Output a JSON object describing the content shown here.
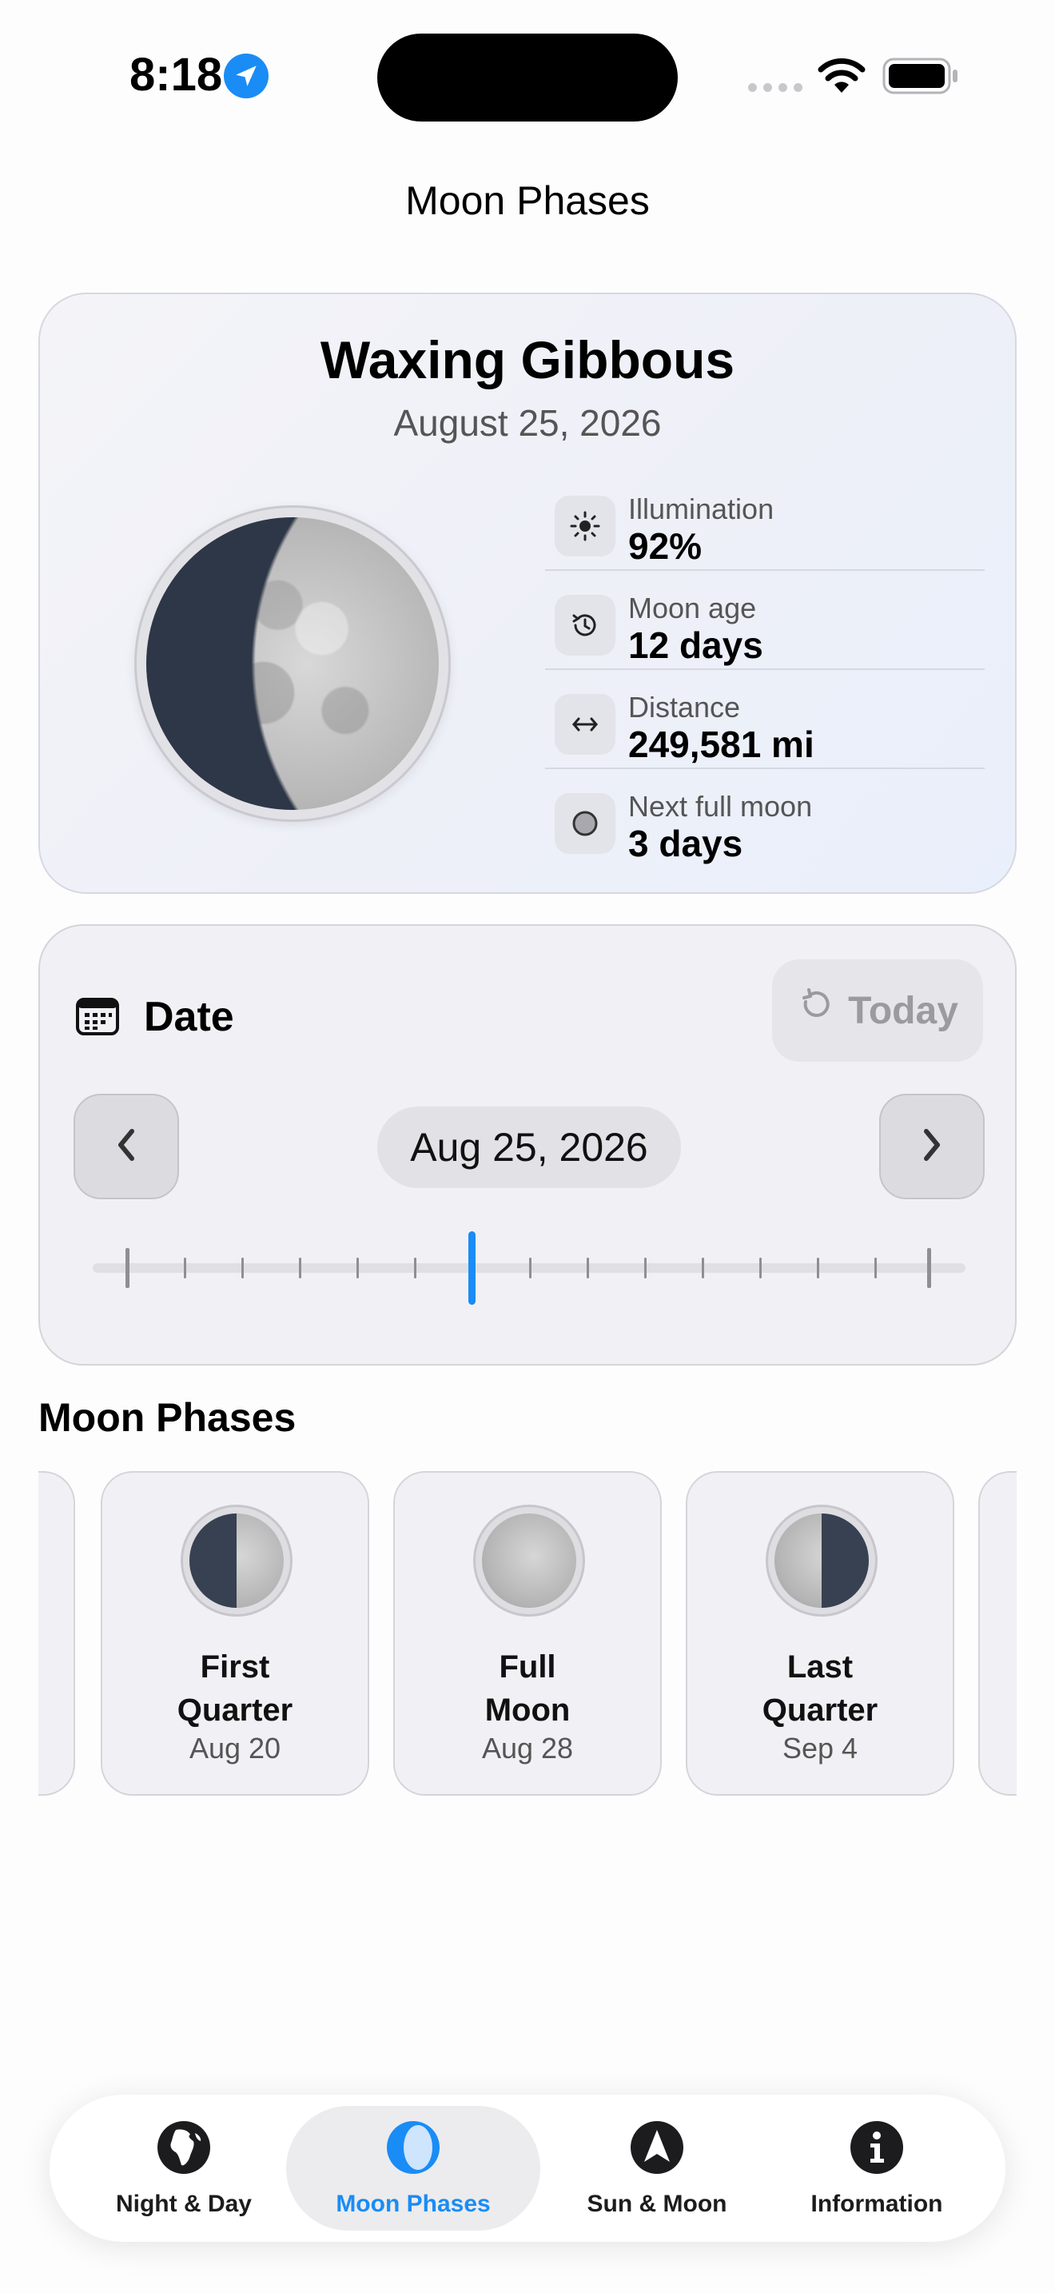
{
  "status_bar": {
    "time": "8:18",
    "icons": [
      "location-arrow-icon",
      "signal-icon",
      "wifi-icon",
      "battery-icon"
    ]
  },
  "header": {
    "title": "Moon Phases"
  },
  "moon_card": {
    "phase_name": "Waxing Gibbous",
    "date": "August 25, 2026",
    "stats": [
      {
        "icon": "sun-icon",
        "label": "Illumination",
        "value": "92%"
      },
      {
        "icon": "history-icon",
        "label": "Moon age",
        "value": "12 days"
      },
      {
        "icon": "arrows-horizontal-icon",
        "label": "Distance",
        "value": "249,581 mi"
      },
      {
        "icon": "circle-icon",
        "label": "Next full moon",
        "value": "3 days"
      }
    ]
  },
  "date_card": {
    "heading": "Date",
    "today_label": "Today",
    "selected_date": "Aug 25, 2026"
  },
  "phases_section": {
    "title": "Moon Phases",
    "items": [
      {
        "name_line1": "First",
        "name_line2": "Quarter",
        "date": "Aug 20"
      },
      {
        "name_line1": "Full",
        "name_line2": "Moon",
        "date": "Aug 28"
      },
      {
        "name_line1": "Last",
        "name_line2": "Quarter",
        "date": "Sep 4"
      }
    ]
  },
  "tab_bar": {
    "tabs": [
      {
        "label": "Night & Day",
        "icon": "globe-africa-icon",
        "active": false
      },
      {
        "label": "Moon Phases",
        "icon": "moon-phase-icon",
        "active": true
      },
      {
        "label": "Sun & Moon",
        "icon": "navigation-arrow-icon",
        "active": false
      },
      {
        "label": "Information",
        "icon": "info-icon",
        "active": false
      }
    ]
  },
  "colors": {
    "accent": "#1a8cf5",
    "card_background": "#f1f1f5",
    "text_secondary": "#555555"
  }
}
